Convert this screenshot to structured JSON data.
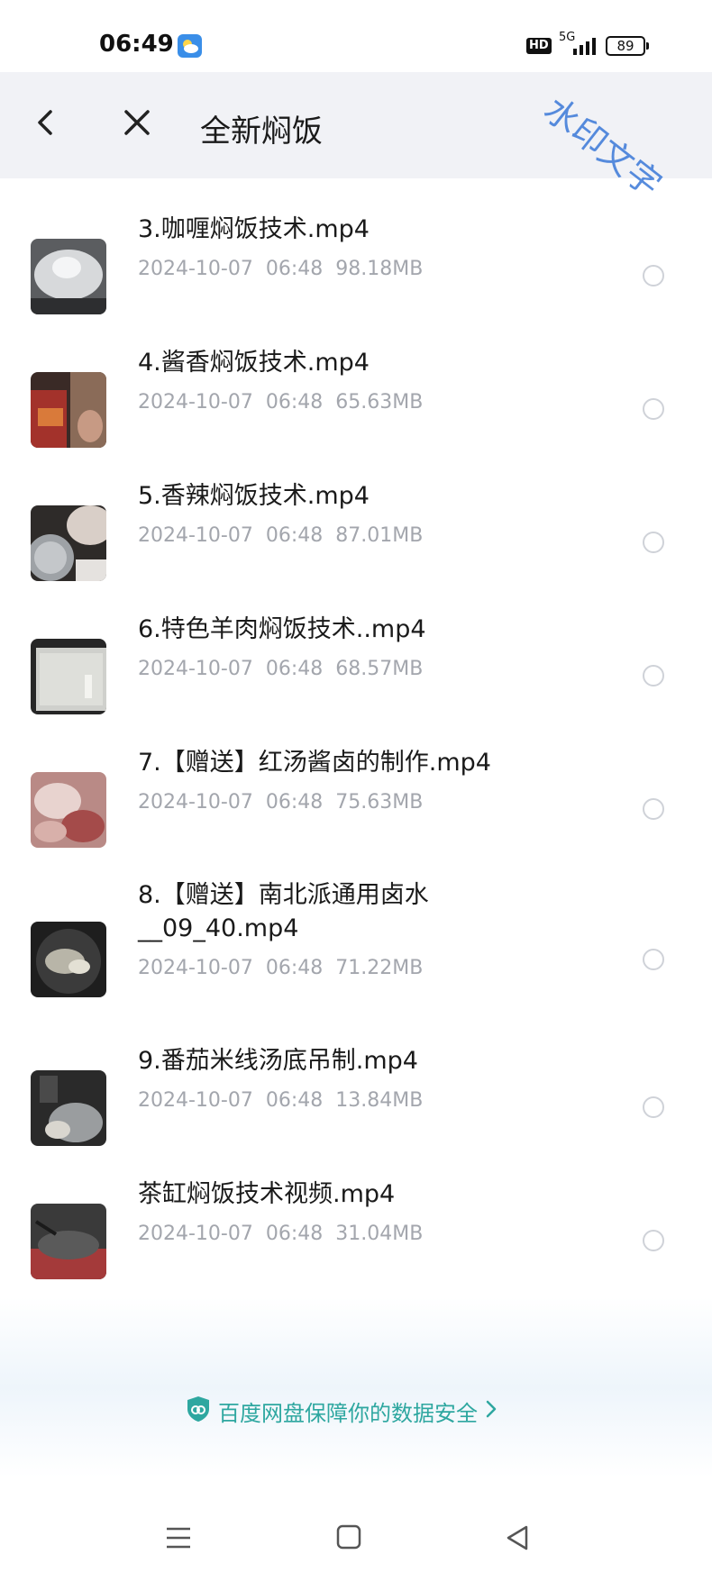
{
  "status_bar": {
    "time": "06:49",
    "hd_label": "HD",
    "network_label": "5G",
    "battery_level": "89"
  },
  "header": {
    "title": "全新焖饭",
    "watermark": "水印文字"
  },
  "files": [
    {
      "name": "3.咖喱焖饭技术.mp4",
      "date": "2024-10-07",
      "time": "06:48",
      "size": "98.18MB"
    },
    {
      "name": "4.酱香焖饭技术.mp4",
      "date": "2024-10-07",
      "time": "06:48",
      "size": "65.63MB"
    },
    {
      "name": "5.香辣焖饭技术.mp4",
      "date": "2024-10-07",
      "time": "06:48",
      "size": "87.01MB"
    },
    {
      "name": "6.特色羊肉焖饭技术..mp4",
      "date": "2024-10-07",
      "time": "06:48",
      "size": "68.57MB"
    },
    {
      "name": "7.【赠送】红汤酱卤的制作.mp4",
      "date": "2024-10-07",
      "time": "06:48",
      "size": "75.63MB"
    },
    {
      "name": "8.【赠送】南北派通用卤水\n__09_40.mp4",
      "date": "2024-10-07",
      "time": "06:48",
      "size": "71.22MB"
    },
    {
      "name": "9.番茄米线汤底吊制.mp4",
      "date": "2024-10-07",
      "time": "06:48",
      "size": "13.84MB"
    },
    {
      "name": "茶缸焖饭技术视频.mp4",
      "date": "2024-10-07",
      "time": "06:48",
      "size": "31.04MB"
    }
  ],
  "footer": {
    "security_text": "百度网盘保障你的数据安全"
  },
  "icons": {
    "back": "chevron-left-icon",
    "close": "close-icon",
    "radio": "radio-unselected-icon",
    "shield": "shield-icon",
    "chevron": "chevron-right-icon",
    "nav_menu": "menu-icon",
    "nav_home": "home-square-icon",
    "nav_back": "triangle-back-icon"
  },
  "colors": {
    "header_bg": "#f1f2f6",
    "meta_text": "#a3a6ad",
    "security_accent": "#2ea7a0",
    "watermark": "#3a78d8"
  }
}
